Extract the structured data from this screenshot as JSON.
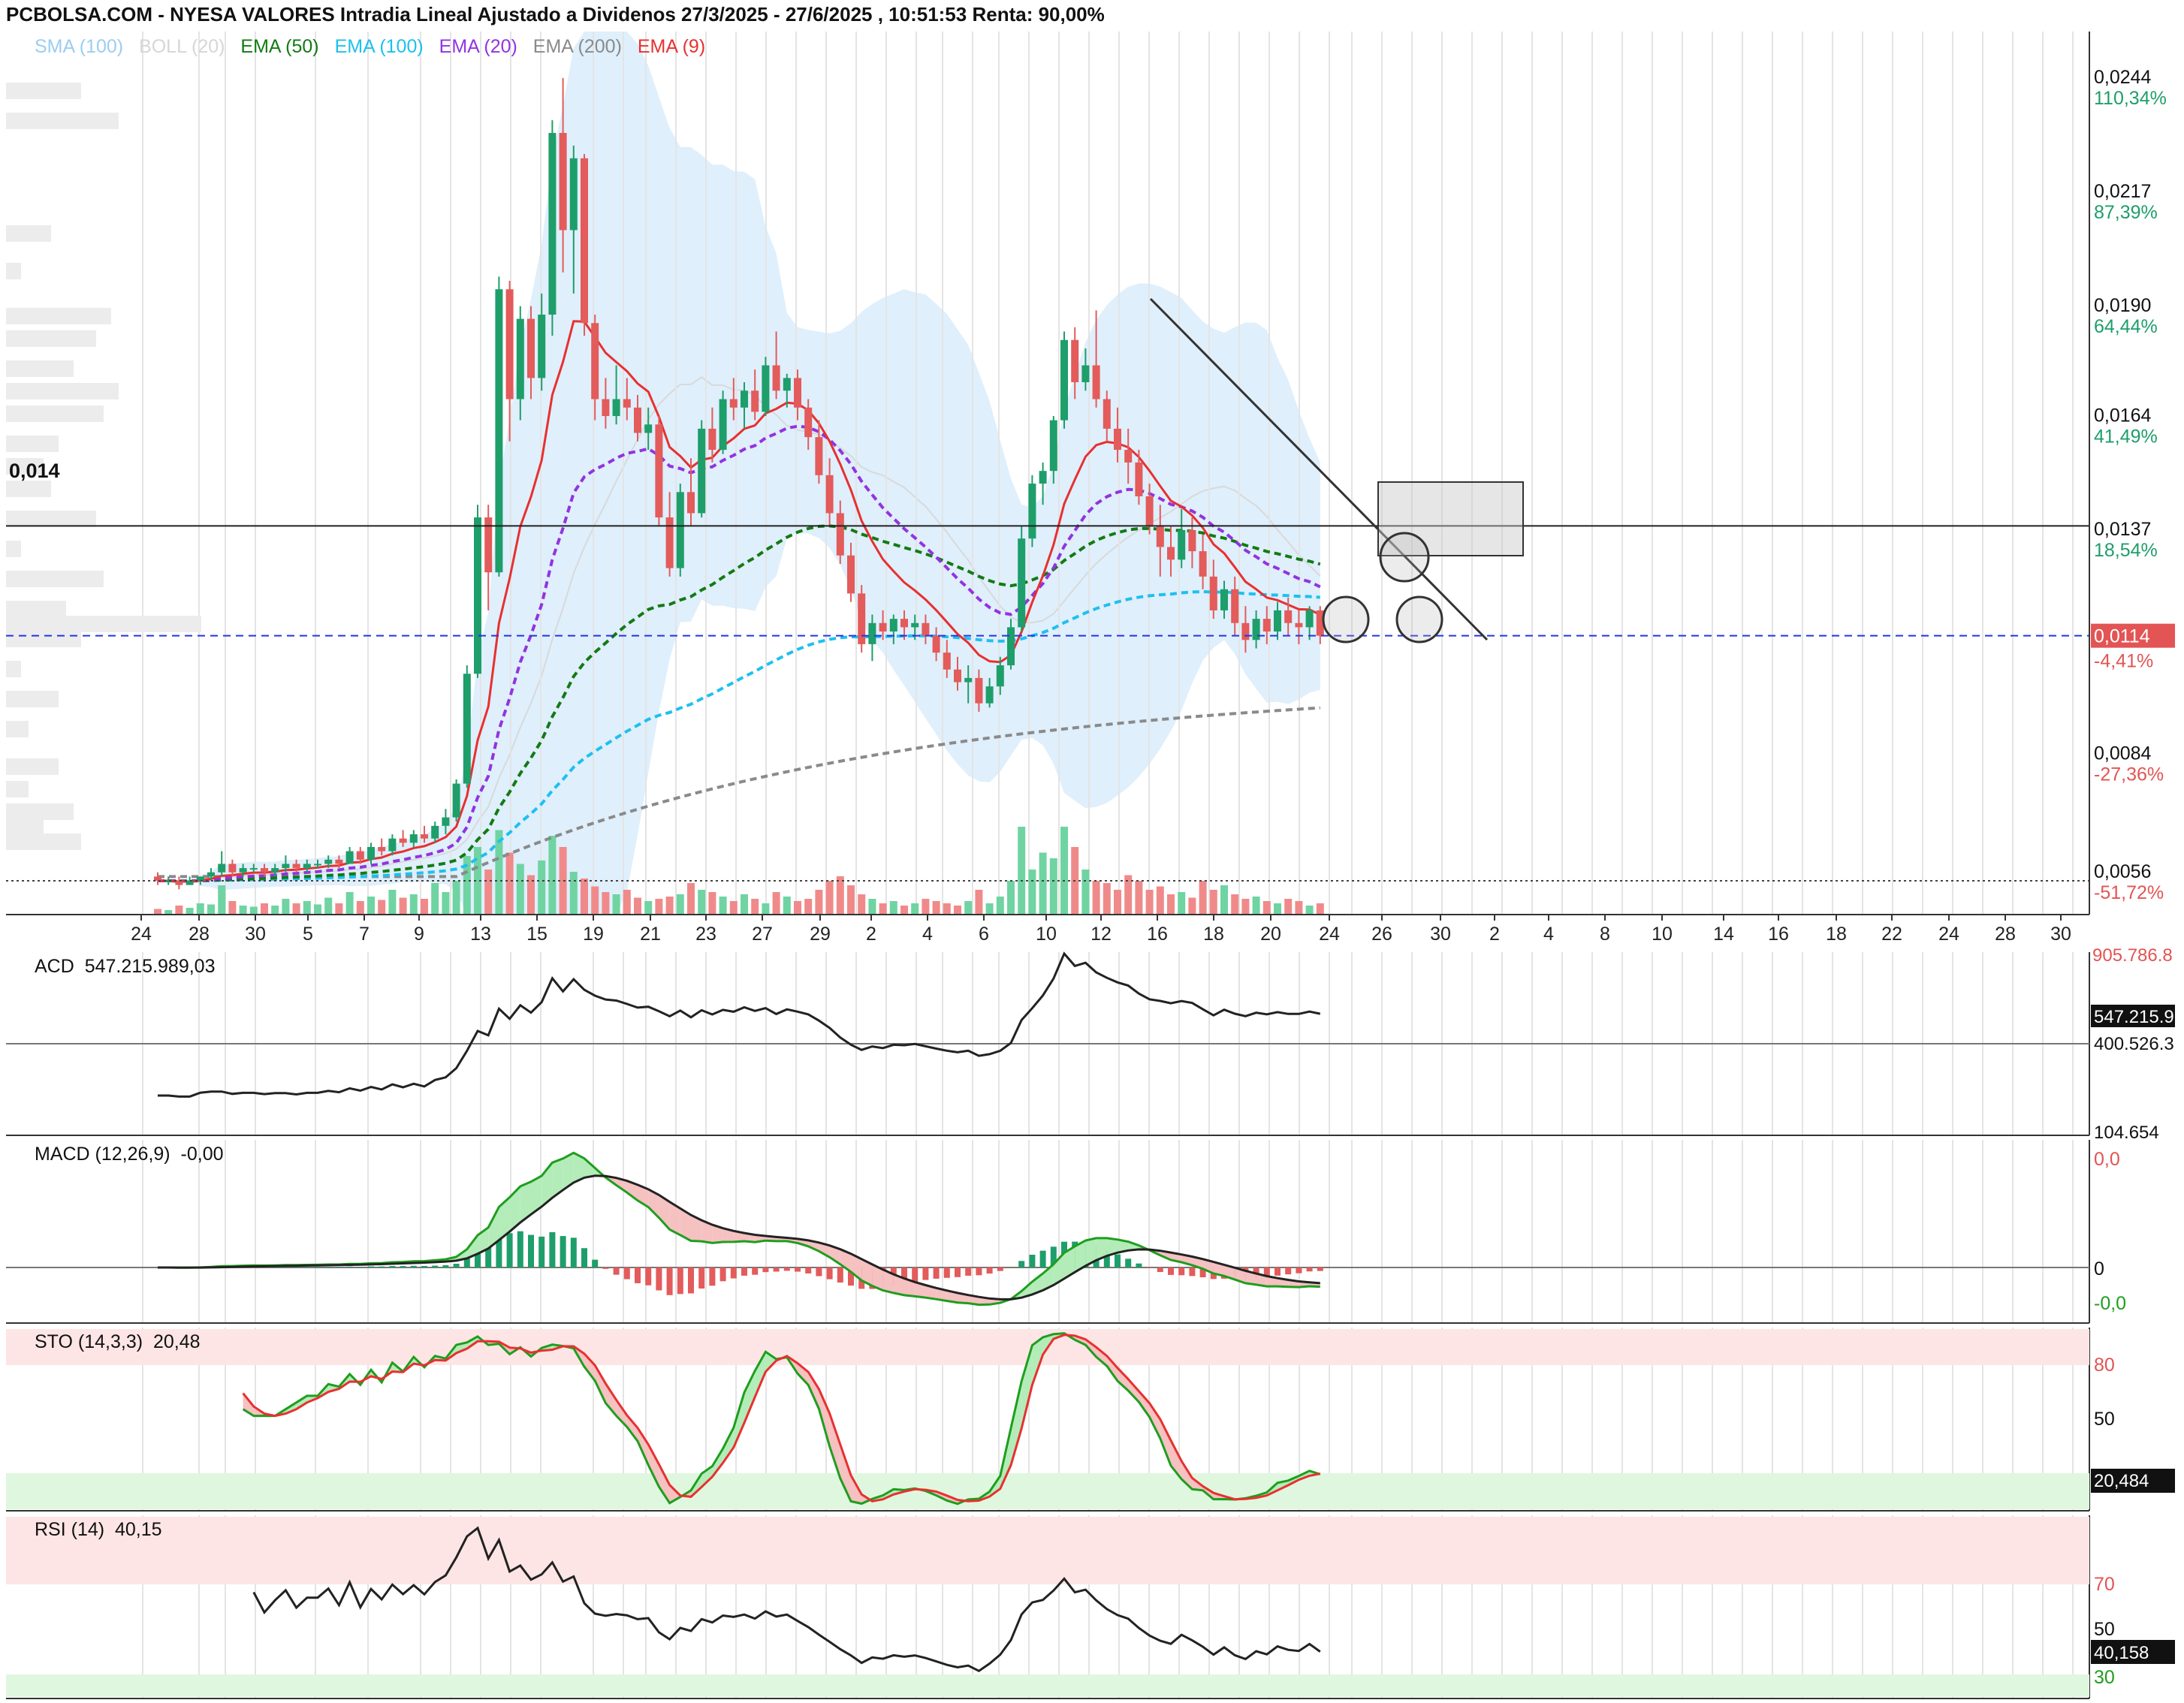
{
  "header": {
    "title": "PCBOLSA.COM - NYESA VALORES Intradia Lineal Ajustado a Dividenos 27/3/2025 - 27/6/2025 , 10:51:53 Renta: 90,00%"
  },
  "legend": [
    {
      "label": "SMA (100)",
      "color": "#9ccdf0"
    },
    {
      "label": "BOLL (20)",
      "color": "#d6d6d6"
    },
    {
      "label": "EMA (50)",
      "color": "#137a13"
    },
    {
      "label": "EMA (100)",
      "color": "#1ec0ef"
    },
    {
      "label": "EMA (20)",
      "color": "#9233e0"
    },
    {
      "label": "EMA (200)",
      "color": "#8a8a8a"
    },
    {
      "label": "EMA (9)",
      "color": "#e83030"
    }
  ],
  "colors": {
    "up": "#1e9e6a",
    "down": "#e35b5b",
    "volume_up": "#6fd4a2",
    "volume_down": "#f08a8a",
    "band": "#d9ecfb",
    "last_price_line": "#2434e6",
    "last_price_tag": "#e35454",
    "macd_fill_up": "#b3ecb8",
    "macd_fill_down": "#f5c1c1",
    "overbought_zone": "#fde5e5",
    "oversold_zone": "#dff7df"
  },
  "levels": {
    "resistance_label": "0,014"
  },
  "chart_data": {
    "type": "candlestick",
    "x_tick_labels": [
      "24",
      "28",
      "30",
      "5",
      "7",
      "9",
      "13",
      "15",
      "19",
      "21",
      "23",
      "27",
      "29",
      "2",
      "4",
      "6",
      "10",
      "12",
      "16",
      "18",
      "20",
      "24",
      "26",
      "30",
      "2",
      "4",
      "8",
      "10",
      "14",
      "16",
      "18",
      "22",
      "24",
      "28",
      "30"
    ],
    "price_axis": [
      {
        "price": "0,0244",
        "pct": "110,34%",
        "pct_color": "#1e9e6a"
      },
      {
        "price": "0,0217",
        "pct": "87,39%",
        "pct_color": "#1e9e6a"
      },
      {
        "price": "0,0190",
        "pct": "64,44%",
        "pct_color": "#1e9e6a"
      },
      {
        "price": "0,0164",
        "pct": "41,49%",
        "pct_color": "#1e9e6a"
      },
      {
        "price": "0,0137",
        "pct": "18,54%",
        "pct_color": "#1e9e6a"
      },
      {
        "price": "0,0084",
        "pct": "-27,36%",
        "pct_color": "#e35454"
      },
      {
        "price": "0,0056",
        "pct": "-51,72%",
        "pct_color": "#e35454"
      }
    ],
    "last_price": {
      "value": "0,0114",
      "pct": "-4,41%"
    },
    "ylim": [
      0.0048,
      0.0257
    ],
    "price_ohlc": [
      [
        0.0057,
        0.0058,
        0.0055,
        0.0056
      ],
      [
        0.0056,
        0.0057,
        0.0055,
        0.0056
      ],
      [
        0.0056,
        0.0057,
        0.0054,
        0.0055
      ],
      [
        0.0055,
        0.0057,
        0.0055,
        0.0056
      ],
      [
        0.0056,
        0.0057,
        0.0055,
        0.0057
      ],
      [
        0.0057,
        0.0059,
        0.0056,
        0.0058
      ],
      [
        0.0058,
        0.0063,
        0.0057,
        0.006
      ],
      [
        0.006,
        0.0061,
        0.0057,
        0.0058
      ],
      [
        0.0058,
        0.006,
        0.0057,
        0.0059
      ],
      [
        0.0059,
        0.006,
        0.0058,
        0.0059
      ],
      [
        0.0059,
        0.006,
        0.0057,
        0.0058
      ],
      [
        0.0058,
        0.006,
        0.0057,
        0.0059
      ],
      [
        0.0059,
        0.0062,
        0.0058,
        0.006
      ],
      [
        0.006,
        0.0061,
        0.0058,
        0.0059
      ],
      [
        0.0059,
        0.0061,
        0.0058,
        0.006
      ],
      [
        0.006,
        0.0061,
        0.0059,
        0.006
      ],
      [
        0.006,
        0.0062,
        0.0059,
        0.0061
      ],
      [
        0.0061,
        0.0062,
        0.0059,
        0.006
      ],
      [
        0.006,
        0.0064,
        0.006,
        0.0063
      ],
      [
        0.0063,
        0.0064,
        0.006,
        0.0061
      ],
      [
        0.0061,
        0.0065,
        0.006,
        0.0064
      ],
      [
        0.0064,
        0.0066,
        0.0062,
        0.0063
      ],
      [
        0.0063,
        0.0067,
        0.0062,
        0.0066
      ],
      [
        0.0066,
        0.0068,
        0.0064,
        0.0065
      ],
      [
        0.0065,
        0.0068,
        0.0064,
        0.0067
      ],
      [
        0.0067,
        0.0069,
        0.0065,
        0.0066
      ],
      [
        0.0066,
        0.007,
        0.0065,
        0.0069
      ],
      [
        0.0069,
        0.0073,
        0.0067,
        0.0071
      ],
      [
        0.0071,
        0.008,
        0.007,
        0.0079
      ],
      [
        0.0079,
        0.0107,
        0.0078,
        0.0105
      ],
      [
        0.0105,
        0.0145,
        0.0104,
        0.0142
      ],
      [
        0.0142,
        0.0145,
        0.012,
        0.0129
      ],
      [
        0.0129,
        0.0199,
        0.0128,
        0.0196
      ],
      [
        0.0196,
        0.0198,
        0.016,
        0.017
      ],
      [
        0.017,
        0.0192,
        0.0165,
        0.0189
      ],
      [
        0.0189,
        0.0192,
        0.017,
        0.0175
      ],
      [
        0.0175,
        0.0195,
        0.0172,
        0.019
      ],
      [
        0.019,
        0.0236,
        0.0185,
        0.0233
      ],
      [
        0.0233,
        0.0246,
        0.02,
        0.021
      ],
      [
        0.021,
        0.023,
        0.0195,
        0.0227
      ],
      [
        0.0227,
        0.0228,
        0.0185,
        0.0188
      ],
      [
        0.0188,
        0.019,
        0.0165,
        0.017
      ],
      [
        0.017,
        0.0175,
        0.0163,
        0.0166
      ],
      [
        0.0166,
        0.0178,
        0.0164,
        0.017
      ],
      [
        0.017,
        0.0175,
        0.0165,
        0.0168
      ],
      [
        0.0168,
        0.0171,
        0.016,
        0.0162
      ],
      [
        0.0162,
        0.0168,
        0.0158,
        0.0164
      ],
      [
        0.0164,
        0.0166,
        0.014,
        0.0142
      ],
      [
        0.0142,
        0.0148,
        0.0128,
        0.013
      ],
      [
        0.013,
        0.015,
        0.0128,
        0.0148
      ],
      [
        0.0148,
        0.0156,
        0.014,
        0.0143
      ],
      [
        0.0143,
        0.0165,
        0.0142,
        0.0163
      ],
      [
        0.0163,
        0.0168,
        0.0155,
        0.0158
      ],
      [
        0.0158,
        0.0172,
        0.0157,
        0.017
      ],
      [
        0.017,
        0.0175,
        0.0165,
        0.0168
      ],
      [
        0.0168,
        0.0174,
        0.0163,
        0.0172
      ],
      [
        0.0172,
        0.0177,
        0.0165,
        0.0167
      ],
      [
        0.0167,
        0.018,
        0.0166,
        0.0178
      ],
      [
        0.0178,
        0.0186,
        0.017,
        0.0172
      ],
      [
        0.0172,
        0.0176,
        0.0168,
        0.0175
      ],
      [
        0.0175,
        0.0177,
        0.0165,
        0.0168
      ],
      [
        0.0168,
        0.017,
        0.0158,
        0.0161
      ],
      [
        0.0161,
        0.0165,
        0.015,
        0.0152
      ],
      [
        0.0152,
        0.0156,
        0.014,
        0.0143
      ],
      [
        0.0143,
        0.0146,
        0.0131,
        0.0133
      ],
      [
        0.0133,
        0.0136,
        0.0122,
        0.0124
      ],
      [
        0.0124,
        0.0126,
        0.011,
        0.0112
      ],
      [
        0.0112,
        0.0119,
        0.0108,
        0.0117
      ],
      [
        0.0117,
        0.012,
        0.0113,
        0.0115
      ],
      [
        0.0115,
        0.0119,
        0.0112,
        0.0118
      ],
      [
        0.0118,
        0.012,
        0.0113,
        0.0116
      ],
      [
        0.0116,
        0.0119,
        0.0113,
        0.0117
      ],
      [
        0.0117,
        0.0119,
        0.0112,
        0.0114
      ],
      [
        0.0114,
        0.0116,
        0.0108,
        0.011
      ],
      [
        0.011,
        0.0113,
        0.0104,
        0.0106
      ],
      [
        0.0106,
        0.0109,
        0.0101,
        0.0103
      ],
      [
        0.0103,
        0.0107,
        0.0098,
        0.0104
      ],
      [
        0.0104,
        0.0106,
        0.0096,
        0.0098
      ],
      [
        0.0098,
        0.0104,
        0.0097,
        0.0102
      ],
      [
        0.0102,
        0.0109,
        0.01,
        0.0107
      ],
      [
        0.0107,
        0.0118,
        0.0106,
        0.0116
      ],
      [
        0.0116,
        0.014,
        0.0115,
        0.0137
      ],
      [
        0.0137,
        0.0152,
        0.0135,
        0.015
      ],
      [
        0.015,
        0.0155,
        0.0145,
        0.0153
      ],
      [
        0.0153,
        0.0166,
        0.015,
        0.0165
      ],
      [
        0.0165,
        0.0186,
        0.0163,
        0.0184
      ],
      [
        0.0184,
        0.0187,
        0.017,
        0.0174
      ],
      [
        0.0174,
        0.0182,
        0.0172,
        0.0178
      ],
      [
        0.0178,
        0.0191,
        0.0168,
        0.017
      ],
      [
        0.017,
        0.0172,
        0.016,
        0.0163
      ],
      [
        0.0163,
        0.0168,
        0.0155,
        0.0158
      ],
      [
        0.0158,
        0.0163,
        0.015,
        0.0155
      ],
      [
        0.0155,
        0.0158,
        0.0145,
        0.0147
      ],
      [
        0.0147,
        0.015,
        0.0138,
        0.014
      ],
      [
        0.014,
        0.0145,
        0.0128,
        0.0135
      ],
      [
        0.0135,
        0.014,
        0.0128,
        0.0132
      ],
      [
        0.0132,
        0.0144,
        0.013,
        0.0139
      ],
      [
        0.0139,
        0.0142,
        0.013,
        0.0134
      ],
      [
        0.0134,
        0.0138,
        0.0125,
        0.0128
      ],
      [
        0.0128,
        0.0132,
        0.0118,
        0.012
      ],
      [
        0.012,
        0.0127,
        0.0118,
        0.0125
      ],
      [
        0.0125,
        0.0128,
        0.0114,
        0.0117
      ],
      [
        0.0117,
        0.0121,
        0.011,
        0.0113
      ],
      [
        0.0113,
        0.012,
        0.0111,
        0.0118
      ],
      [
        0.0118,
        0.0121,
        0.0112,
        0.0115
      ],
      [
        0.0115,
        0.0122,
        0.0113,
        0.012
      ],
      [
        0.012,
        0.0123,
        0.0114,
        0.0117
      ],
      [
        0.0117,
        0.012,
        0.0112,
        0.0116
      ],
      [
        0.0116,
        0.0121,
        0.0113,
        0.012
      ],
      [
        0.012,
        0.0121,
        0.0112,
        0.0114
      ]
    ],
    "volume": [
      0.05,
      0.04,
      0.08,
      0.06,
      0.1,
      0.09,
      0.26,
      0.12,
      0.08,
      0.07,
      0.1,
      0.08,
      0.14,
      0.1,
      0.12,
      0.09,
      0.15,
      0.1,
      0.2,
      0.12,
      0.16,
      0.13,
      0.22,
      0.15,
      0.18,
      0.14,
      0.28,
      0.2,
      0.3,
      0.52,
      0.6,
      0.4,
      0.75,
      0.55,
      0.45,
      0.35,
      0.48,
      0.7,
      0.6,
      0.38,
      0.32,
      0.25,
      0.2,
      0.18,
      0.22,
      0.15,
      0.12,
      0.14,
      0.16,
      0.18,
      0.28,
      0.22,
      0.2,
      0.16,
      0.12,
      0.18,
      0.14,
      0.1,
      0.2,
      0.16,
      0.12,
      0.14,
      0.22,
      0.3,
      0.34,
      0.26,
      0.18,
      0.14,
      0.1,
      0.12,
      0.08,
      0.1,
      0.14,
      0.12,
      0.1,
      0.08,
      0.12,
      0.22,
      0.1,
      0.16,
      0.3,
      0.78,
      0.4,
      0.55,
      0.5,
      0.78,
      0.6,
      0.4,
      0.3,
      0.28,
      0.22,
      0.35,
      0.3,
      0.22,
      0.25,
      0.18,
      0.2,
      0.15,
      0.3,
      0.22,
      0.26,
      0.18,
      0.14,
      0.16,
      0.12,
      0.1,
      0.14,
      0.12,
      0.08,
      0.1
    ],
    "indicators": {
      "acd": {
        "label": "ACD",
        "value": "547.215.989,03",
        "tag": "547.215.9",
        "scale_mid": "400.526.3",
        "scale_top": "905.786.8",
        "scale_bottom": "104.654"
      },
      "macd": {
        "label": "MACD (12,26,9)",
        "value": "-0,00",
        "scale": [
          "0,0",
          "0",
          "-0,0"
        ]
      },
      "sto": {
        "label": "STO (14,3,3)",
        "value": "20,48",
        "tag": "20,484",
        "scale": [
          "80",
          "50"
        ],
        "overbought": 80,
        "oversold": 20
      },
      "rsi": {
        "label": "RSI (14)",
        "value": "40,15",
        "tag": "40,158",
        "scale": [
          "70",
          "50",
          "30"
        ],
        "overbought": 70,
        "oversold": 30
      }
    }
  }
}
